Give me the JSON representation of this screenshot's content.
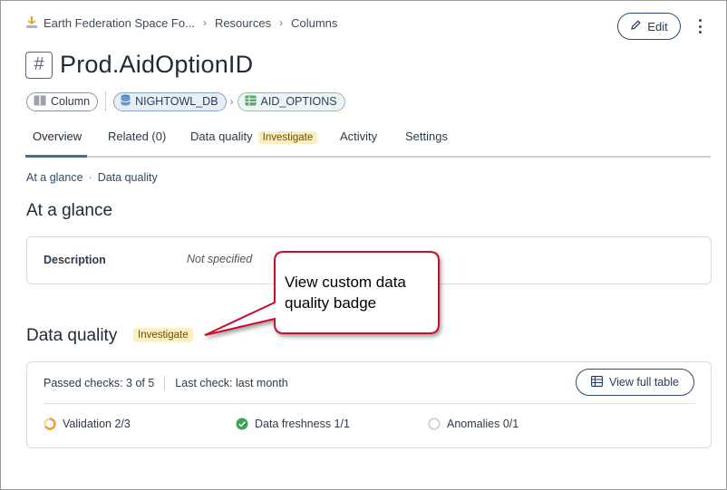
{
  "breadcrumb": {
    "items": [
      "Earth Federation Space Fo...",
      "Resources",
      "Columns"
    ]
  },
  "header": {
    "edit_label": "Edit",
    "title": "Prod.AidOptionID",
    "type_glyph": "#"
  },
  "chips": {
    "type": "Column",
    "database": "NIGHTOWL_DB",
    "table": "AID_OPTIONS"
  },
  "tabs": [
    {
      "label": "Overview",
      "active": true
    },
    {
      "label": "Related (0)"
    },
    {
      "label": "Data quality",
      "badge": "Investigate"
    },
    {
      "label": "Activity"
    },
    {
      "label": "Settings"
    }
  ],
  "anchors": {
    "glance": "At a glance",
    "separator": "·",
    "quality": "Data quality"
  },
  "glance": {
    "heading": "At a glance",
    "description_label": "Description",
    "description_value": "Not specified"
  },
  "data_quality": {
    "heading": "Data quality",
    "badge": "Investigate",
    "passed_checks": "Passed checks: 3 of 5",
    "last_check": "Last check: last month",
    "view_full_table": "View full table",
    "checks": [
      {
        "label": "Validation 2/3",
        "status": "partial",
        "color": "#f29a2e"
      },
      {
        "label": "Data freshness 1/1",
        "status": "pass",
        "color": "#34a853"
      },
      {
        "label": "Anomalies 0/1",
        "status": "none",
        "color": "#c9ced4"
      }
    ]
  },
  "callout": {
    "text": "View custom data quality badge",
    "border_color": "#c8102e"
  },
  "colors": {
    "accent": "#3a6fa8",
    "badge_bg": "#fbf0c2",
    "badge_text": "#6b4f06",
    "brand_icon": "#e8a317"
  },
  "icons": {
    "breadcrumb": "ship-icon",
    "edit": "pencil-icon",
    "more": "kebab-icon",
    "column": "column-icon",
    "database": "database-icon",
    "table": "table-icon",
    "view_table": "table-icon"
  }
}
